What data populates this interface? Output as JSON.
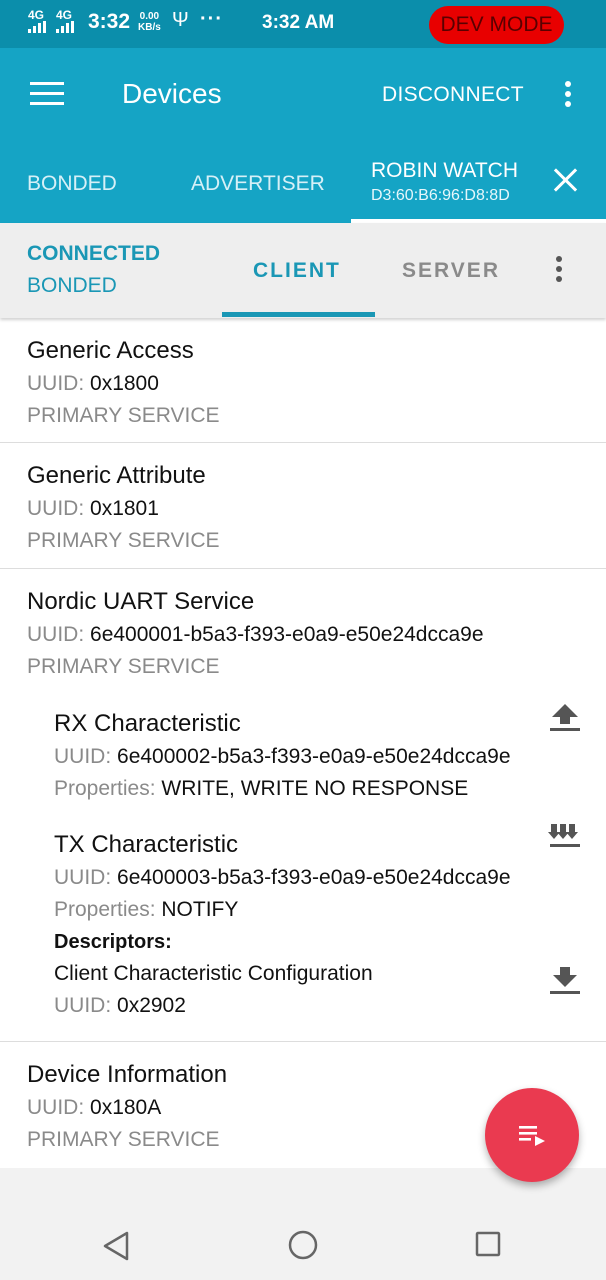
{
  "status_bar": {
    "signal1_label": "4G",
    "signal2_label": "4G",
    "time_left": "3:32",
    "net_speed_value": "0.00",
    "net_speed_unit": "KB/s",
    "more_indicator": "···",
    "clock": "3:32 AM",
    "dev_mode_label": "DEV MODE"
  },
  "app_bar": {
    "title": "Devices",
    "disconnect_label": "DISCONNECT"
  },
  "device_tabs": {
    "bonded_label": "BONDED",
    "advertiser_label": "ADVERTISER",
    "active_device_name": "ROBIN WATCH",
    "active_device_mac": "D3:60:B6:96:D8:8D"
  },
  "sub_bar": {
    "connection_state": "CONNECTED",
    "bond_state": "BONDED",
    "client_tab": "CLIENT",
    "server_tab": "SERVER"
  },
  "labels": {
    "uuid": "UUID:",
    "properties": "Properties:",
    "descriptors": "Descriptors:"
  },
  "services": [
    {
      "name": "Generic Access",
      "uuid": "0x1800",
      "type": "PRIMARY SERVICE"
    },
    {
      "name": "Generic Attribute",
      "uuid": "0x1801",
      "type": "PRIMARY SERVICE"
    },
    {
      "name": "Nordic UART Service",
      "uuid": "6e400001-b5a3-f393-e0a9-e50e24dcca9e",
      "type": "PRIMARY SERVICE",
      "characteristics": [
        {
          "name": "RX Characteristic",
          "uuid": "6e400002-b5a3-f393-e0a9-e50e24dcca9e",
          "properties": "WRITE, WRITE NO RESPONSE",
          "action_icon": "upload-icon"
        },
        {
          "name": "TX Characteristic",
          "uuid": "6e400003-b5a3-f393-e0a9-e50e24dcca9e",
          "properties": "NOTIFY",
          "action_icon": "notify-multiple-download-icon",
          "descriptors": [
            {
              "name": "Client Characteristic Configuration",
              "uuid": "0x2902",
              "action_icon": "download-icon"
            }
          ]
        }
      ]
    },
    {
      "name": "Device Information",
      "uuid": "0x180A",
      "type": "PRIMARY SERVICE"
    }
  ],
  "fab": {
    "icon": "log-list-icon",
    "color": "#ea3a50"
  },
  "nav_bar": {
    "back_icon": "back-triangle-icon",
    "home_icon": "home-circle-icon",
    "recents_icon": "recents-square-icon"
  },
  "colors": {
    "app_bar": "#15a4c5",
    "status_bar": "#0b8eab",
    "accent": "#1a97b5",
    "dev_mode": "#e80000"
  }
}
